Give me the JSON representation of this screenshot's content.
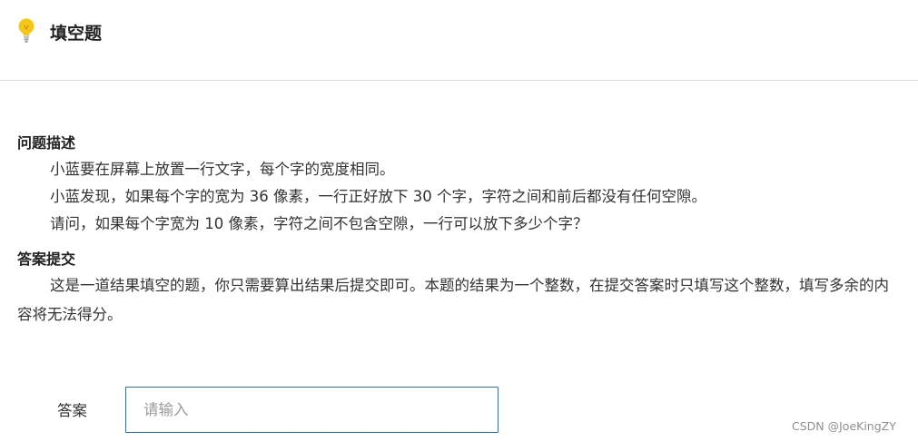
{
  "header": {
    "title": "填空题",
    "icon": "lightbulb-icon"
  },
  "problem": {
    "heading": "问题描述",
    "lines": [
      "小蓝要在屏幕上放置一行文字，每个字的宽度相同。",
      "小蓝发现，如果每个字的宽为 36 像素，一行正好放下 30 个字，字符之间和前后都没有任何空隙。",
      "请问，如果每个字宽为 10 像素，字符之间不包含空隙，一行可以放下多少个字？"
    ]
  },
  "submission": {
    "heading": "答案提交",
    "text": "这是一道结果填空的题，你只需要算出结果后提交即可。本题的结果为一个整数，在提交答案时只填写这个整数，填写多余的内容将无法得分。"
  },
  "answer": {
    "label": "答案",
    "placeholder": "请输入",
    "value": ""
  },
  "watermark": "CSDN @JoeKingZY",
  "colors": {
    "bulb": "#f5c518",
    "input_border": "#3c6e98",
    "divider": "#dedede"
  }
}
